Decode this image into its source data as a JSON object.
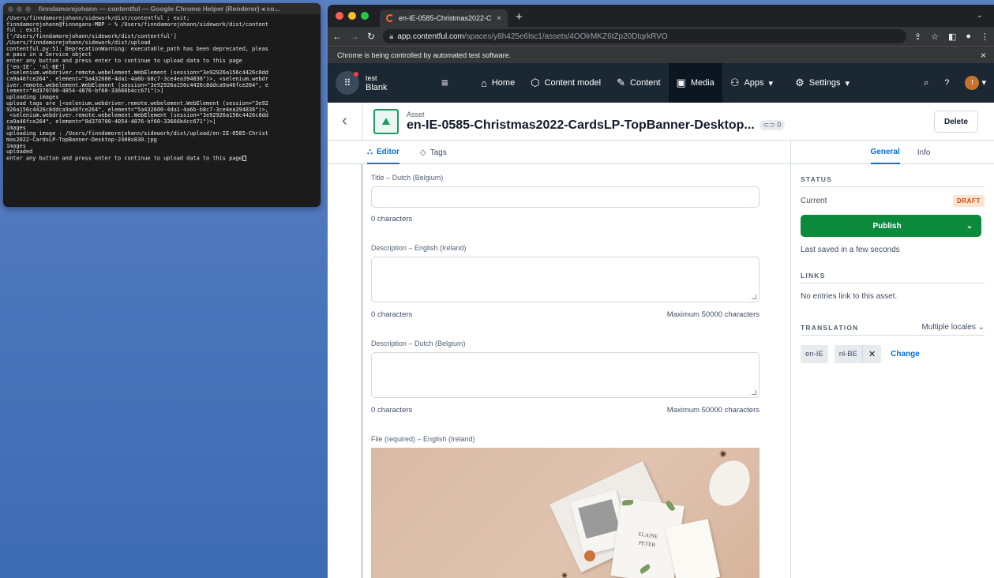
{
  "terminal": {
    "title": "finndamorejohann — contentful — Google Chrome Helper (Renderer) ◂ co...",
    "lines": [
      "/Users/finndamorejohann/sidework/dist/contentful ; exit;",
      "finndamorejohann@finnegans-MBP ~ % /Users/finndamorejohann/sidework/dist/content",
      "ful ; exit;",
      "['/Users/finndamorejohann/sidework/dist/contentful']",
      "/Users/finndamorejohann/sidework/dist/upload",
      "contentful.py:51: DeprecationWarning: executable_path has been deprecated, pleas",
      "e pass in a Service object",
      "enter any button and press enter to continue to upload data to this page",
      "['en-IE', 'nl-BE']",
      "[<selenium.webdriver.remote.webelement.WebElement (session=\"3e92926a156c4426c8dd",
      "ca9a46fce264\", element=\"5a432600-4da1-4a6b-b8c7-3ce4ea394836\")>, <selenium.webdr",
      "iver.remote.webelement.WebElement (session=\"3e92926a156c4426c8ddca9a46fce264\", e",
      "lement=\"8d370700-4054-4876-bf60-33666b4cc671\")>]",
      "uploading images",
      "upload tags are [<selenium.webdriver.remote.webelement.WebElement (session=\"3e92",
      "926a156c4426c8ddca9a46fce264\", element=\"5a432600-4da1-4a6b-b8c7-3ce4ea394836\")>,",
      " <selenium.webdriver.remote.webelement.WebElement (session=\"3e92926a156c4426c8dd",
      "ca9a46fce264\", element=\"8d370700-4054-4876-bf60-33666b4cc671\")>]",
      "images",
      "uploading image : /Users/finndamorejohann/sidework/dist/upload/en-IE-0585-Christ",
      "mas2022-CardsLP-TopBanner-Desktop-2400x830.jpg",
      "images",
      "uploaded",
      "enter any button and press enter to continue to upload data to this page"
    ]
  },
  "chrome": {
    "tab_title": "en-IE-0585-Christmas2022-C",
    "tab_close": "×",
    "new_tab": "+",
    "tab_menu": "⌄",
    "url_host": "app.contentful.com",
    "url_path": "/spaces/y8h425e6lsc1/assets/4OOlrMKZ6tZp20DtqrkRVO",
    "infobar_text": "Chrome is being controlled by automated test software.",
    "infobar_close": "×"
  },
  "nav": {
    "space_name": "test",
    "environment": "Blank",
    "items": [
      {
        "label": "Home",
        "icon": "⌂"
      },
      {
        "label": "Content model",
        "icon": "⬡"
      },
      {
        "label": "Content",
        "icon": "✎"
      },
      {
        "label": "Media",
        "icon": "▣"
      },
      {
        "label": "Apps",
        "icon": "⚇"
      },
      {
        "label": "Settings",
        "icon": "⚙"
      }
    ],
    "apps_caret": "▾",
    "settings_caret": "▾",
    "avatar_letter": "f"
  },
  "entity": {
    "kind": "Asset",
    "title": "en-IE-0585-Christmas2022-CardsLP-TopBanner-Desktop...",
    "ref_count": "⊂⊃ 0",
    "delete_label": "Delete"
  },
  "editor": {
    "tabs": [
      {
        "label": "Editor",
        "icon": "⛬"
      },
      {
        "label": "Tags",
        "icon": "◇"
      }
    ],
    "fields": {
      "title_nl": {
        "label": "Title – Dutch (Belgium)",
        "count": "0 characters"
      },
      "desc_en": {
        "label": "Description – English (Ireland)",
        "count": "0 characters",
        "max": "Maximum 50000 characters"
      },
      "desc_nl": {
        "label": "Description – Dutch (Belgium)",
        "count": "0 characters",
        "max": "Maximum 50000 characters"
      },
      "file_en": {
        "label": "File (required) – English (Ireland)"
      }
    },
    "card_text_1": "ELAINE",
    "card_text_2": "PETER"
  },
  "sidebar": {
    "tabs": [
      "General",
      "Info"
    ],
    "status_heading": "STATUS",
    "current_label": "Current",
    "draft_badge": "DRAFT",
    "publish_label": "Publish",
    "last_saved": "Last saved in a few seconds",
    "links_heading": "LINKS",
    "links_text": "No entries link to this asset.",
    "translation_heading": "TRANSLATION",
    "translation_mode": "Multiple locales",
    "locales": [
      "en-IE",
      "nl-BE"
    ],
    "change_label": "Change"
  }
}
